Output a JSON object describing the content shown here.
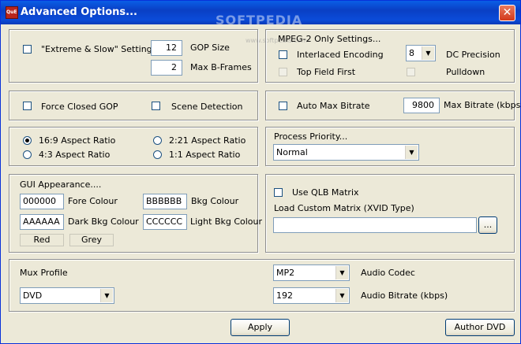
{
  "window": {
    "title": "Advanced Options...",
    "app_icon_text": "QuEnc"
  },
  "watermark": {
    "brand": "SOFTPEDIA",
    "url": "www.softpedia.com"
  },
  "settings": {
    "extreme_label": "\"Extreme & Slow\" Settings",
    "gop_size_value": "12",
    "gop_size_label": "GOP Size",
    "max_bframes_value": "2",
    "max_bframes_label": "Max B-Frames"
  },
  "mpeg2": {
    "title": "MPEG-2 Only Settings...",
    "interlaced_label": "Interlaced Encoding",
    "dc_precision_value": "8",
    "dc_precision_label": "DC Precision",
    "top_field_label": "Top Field First",
    "pulldown_label": "Pulldown"
  },
  "gop": {
    "force_closed_label": "Force Closed GOP",
    "scene_detection_label": "Scene Detection"
  },
  "bitrate": {
    "auto_max_label": "Auto Max Bitrate",
    "max_value": "9800",
    "max_label": "Max Bitrate (kbps)"
  },
  "aspect": {
    "ratio_169": "16:9 Aspect Ratio",
    "ratio_43": "4:3 Aspect Ratio",
    "ratio_221": "2:21 Aspect Ratio",
    "ratio_11": "1:1 Aspect Ratio",
    "selected": "16:9 Aspect Ratio"
  },
  "priority": {
    "title": "Process Priority...",
    "value": "Normal"
  },
  "gui": {
    "title": "GUI Appearance....",
    "fore_value": "000000",
    "fore_label": "Fore Colour",
    "bkg_value": "BBBBBB",
    "bkg_label": "Bkg Colour",
    "dark_value": "AAAAAA",
    "dark_label": "Dark Bkg Colour",
    "light_value": "CCCCCC",
    "light_label": "Light Bkg Colour",
    "red_label": "Red",
    "grey_label": "Grey"
  },
  "matrix": {
    "use_qlb_label": "Use QLB Matrix",
    "load_label": "Load Custom Matrix (XVID Type)",
    "path_value": "",
    "browse_label": "..."
  },
  "mux": {
    "profile_label": "Mux Profile",
    "profile_value": "DVD",
    "audio_codec_value": "MP2",
    "audio_codec_label": "Audio Codec",
    "audio_bitrate_value": "192",
    "audio_bitrate_label": "Audio Bitrate (kbps)"
  },
  "actions": {
    "apply_label": "Apply",
    "author_label": "Author DVD"
  },
  "colors": {
    "title_bar": "#0a5ee6",
    "dialog_bg": "#ece9d8",
    "close_button": "#d3391b"
  }
}
